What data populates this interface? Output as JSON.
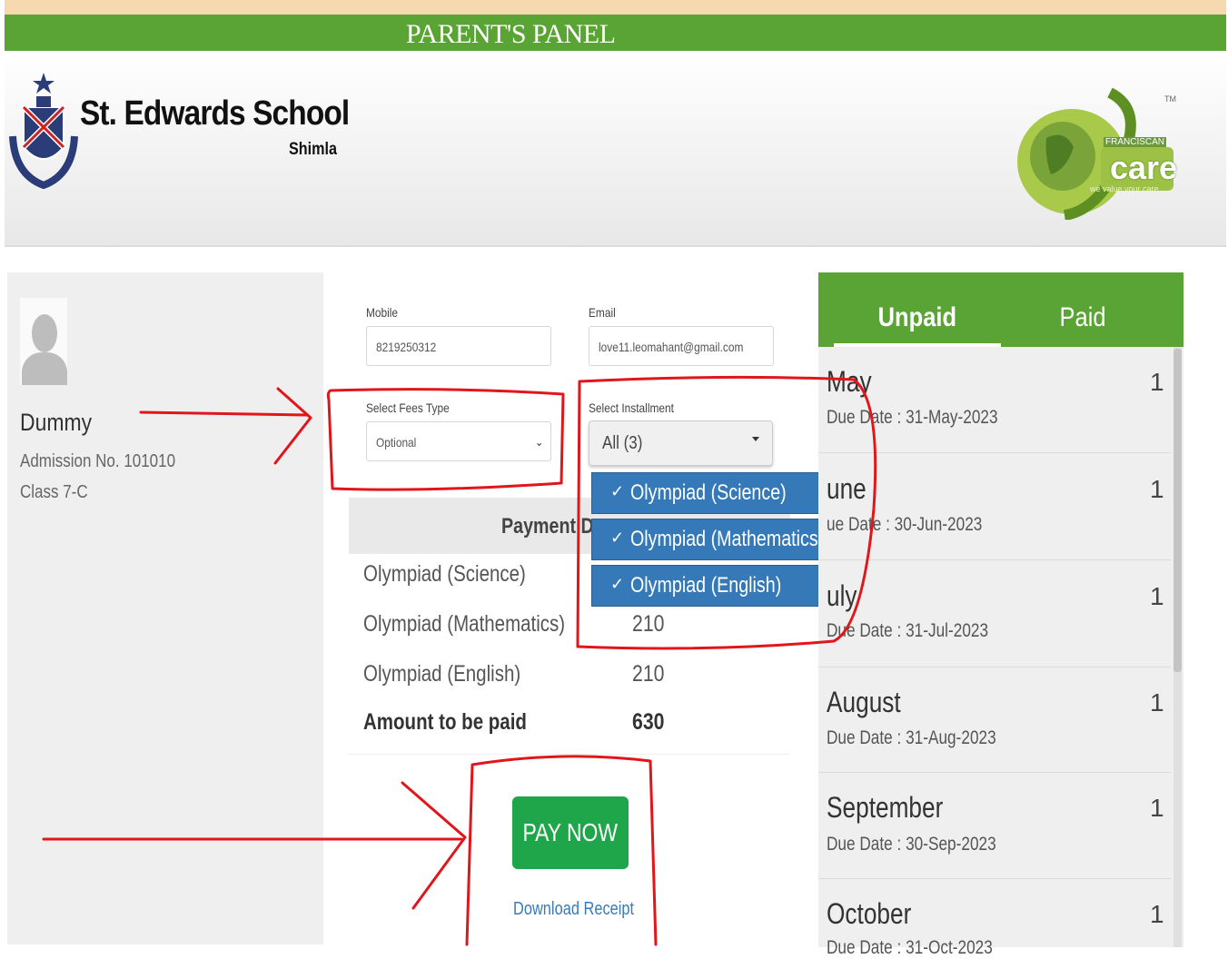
{
  "banner": {
    "title": "PARENT'S PANEL"
  },
  "school": {
    "name": "St. Edwards School",
    "city": "Shimla"
  },
  "partner_logo": {
    "word": "care",
    "brand": "FRANCISCAN",
    "tagline": "we value your care",
    "tm": "TM"
  },
  "student": {
    "name": "Dummy",
    "admission": "Admission No. 101010",
    "class": "Class 7-C",
    "avatar_icon": "user-silhouette-icon"
  },
  "form": {
    "mobile_label": "Mobile",
    "mobile_value": "8219250312",
    "email_label": "Email",
    "email_value": "love11.leomahant@gmail.com",
    "fees_type_label": "Select Fees Type",
    "fees_type_value": "Optional",
    "installment_label": "Select Installment",
    "installment_value": "All (3)",
    "installment_options": [
      {
        "label": "Olympiad (Science)",
        "checked": true
      },
      {
        "label": "Olympiad (Mathematics)",
        "checked": true
      },
      {
        "label": "Olympiad (English)",
        "checked": true
      }
    ]
  },
  "payment": {
    "header": "Payment D",
    "rows": [
      {
        "name": "Olympiad (Science)",
        "amount": ""
      },
      {
        "name": "Olympiad (Mathematics)",
        "amount": "210"
      },
      {
        "name": "Olympiad (English)",
        "amount": "210"
      }
    ],
    "total_label": "Amount to be paid",
    "total_amount": "630"
  },
  "actions": {
    "pay_now": "PAY NOW",
    "download_receipt": "Download Receipt"
  },
  "installments": {
    "tabs": {
      "unpaid": "Unpaid",
      "paid": "Paid"
    },
    "items": [
      {
        "month": "May",
        "due": "Due Date : 31-May-2023",
        "count": "1"
      },
      {
        "month": "une",
        "due": "ue Date : 30-Jun-2023",
        "count": "1"
      },
      {
        "month": "uly",
        "due": "Due Date : 31-Jul-2023",
        "count": "1"
      },
      {
        "month": "August",
        "due": "Due Date : 31-Aug-2023",
        "count": "1"
      },
      {
        "month": "September",
        "due": "Due Date : 30-Sep-2023",
        "count": "1"
      },
      {
        "month": "October",
        "due": "Due Date : 31-Oct-2023",
        "count": "1"
      }
    ]
  },
  "colors": {
    "green": "#5aa435",
    "pay_button": "#1fa64b",
    "dropdown": "#3579b8",
    "annotation": "#e0161b"
  }
}
